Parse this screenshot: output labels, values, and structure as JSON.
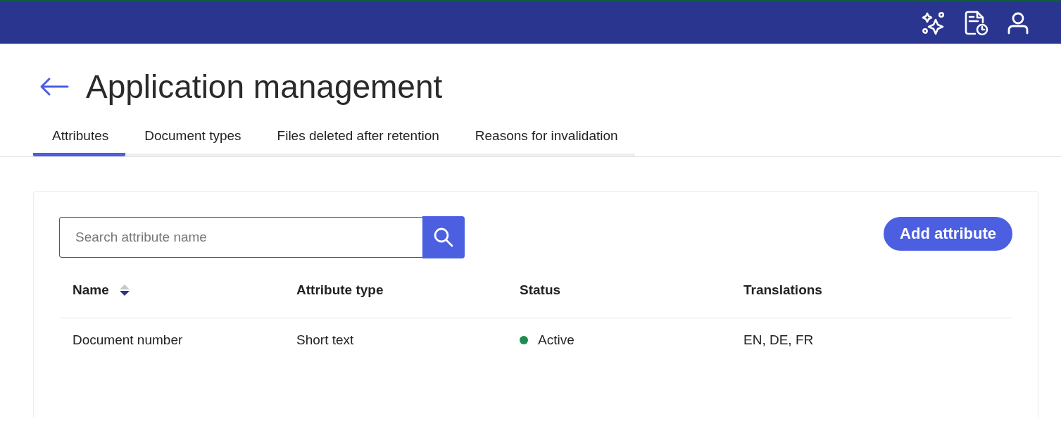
{
  "page": {
    "title": "Application management"
  },
  "tabs": [
    {
      "label": "Attributes",
      "selected": true
    },
    {
      "label": "Document types",
      "selected": false
    },
    {
      "label": "Files deleted after retention",
      "selected": false
    },
    {
      "label": "Reasons for invalidation",
      "selected": false
    }
  ],
  "search": {
    "placeholder": "Search attribute name"
  },
  "add_button": "Add attribute",
  "table": {
    "columns": [
      {
        "label": "Name",
        "sort_descending": true
      },
      {
        "label": "Attribute type"
      },
      {
        "label": "Status"
      },
      {
        "label": "Translations"
      }
    ],
    "rows": [
      {
        "name": "Document number",
        "type": "Short text",
        "status": {
          "label": "Active",
          "color": "#1e8c4e"
        },
        "translations": "EN, DE, FR"
      }
    ]
  }
}
